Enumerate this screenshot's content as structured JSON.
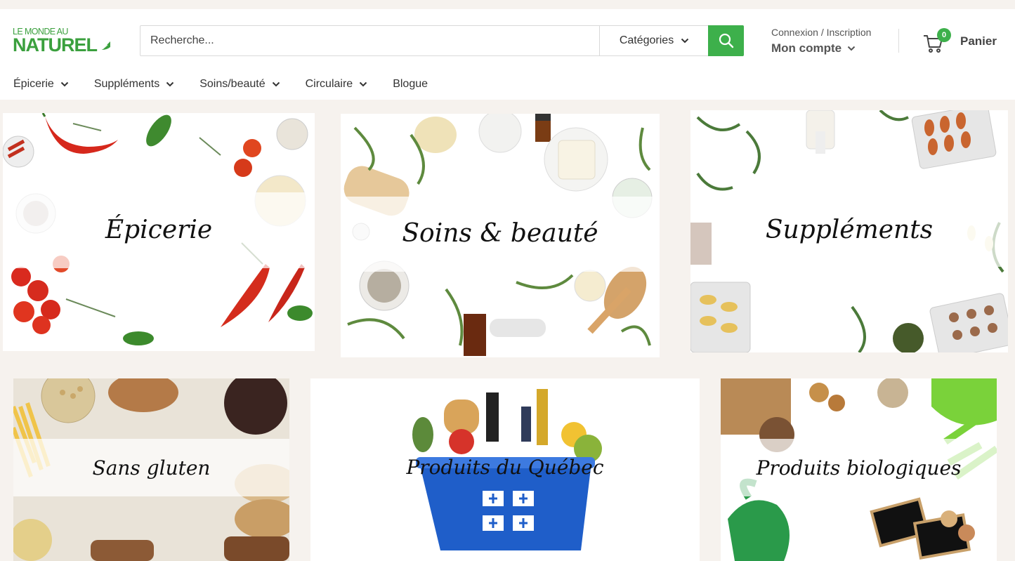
{
  "header": {
    "logo_line1": "LE MONDE AU",
    "logo_line2": "NATUREL",
    "search_placeholder": "Recherche...",
    "categories_label": "Catégories",
    "account_small": "Connexion / Inscription",
    "account_big": "Mon compte",
    "cart_count": "0",
    "cart_label": "Panier",
    "accent_color": "#3db04b"
  },
  "nav": {
    "items": [
      {
        "label": "Épicerie",
        "icon": "chevron-down-icon"
      },
      {
        "label": "Suppléments",
        "icon": "chevron-down-icon"
      },
      {
        "label": "Soins/beauté",
        "icon": "chevron-down-icon"
      },
      {
        "label": "Circulaire",
        "icon": "chevron-down-icon"
      },
      {
        "label": "Blogue"
      }
    ]
  },
  "tiles": [
    {
      "label": "Épicerie"
    },
    {
      "label": "Soins & beauté"
    },
    {
      "label": "Suppléments"
    },
    {
      "label": "Sans gluten"
    },
    {
      "label": "Produits du Québec"
    },
    {
      "label": "Produits biologiques"
    }
  ]
}
